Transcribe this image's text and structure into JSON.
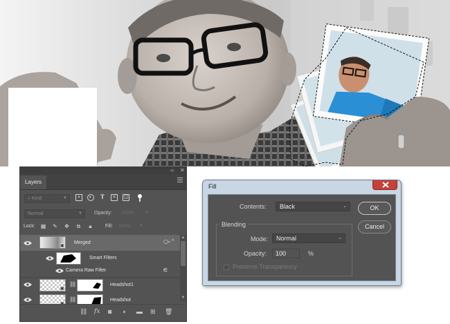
{
  "layers_panel": {
    "tab_label": "Layers",
    "filter_kind": "Kind",
    "blend_mode": "Normal",
    "opacity_label": "Opacity:",
    "opacity_value": "100%",
    "lock_label": "Lock:",
    "fill_label": "Fill:",
    "fill_value": "100%",
    "layers": [
      {
        "name": "Merged"
      },
      {
        "name": "Headshot1"
      },
      {
        "name": "Headshot"
      }
    ],
    "smart_filters_label": "Smart Filters",
    "camera_raw_label": "Camera Raw Filter",
    "fx_label": "fx"
  },
  "fill_dialog": {
    "title": "Fill",
    "contents_label": "Contents:",
    "contents_value": "Black",
    "ok_label": "OK",
    "cancel_label": "Cancel",
    "blending_label": "Blending",
    "mode_label": "Mode:",
    "mode_value": "Normal",
    "opacity_label": "Opacity:",
    "opacity_value": "100",
    "opacity_unit": "%",
    "preserve_label": "Preserve Transparency"
  },
  "colors": {
    "panel_bg": "#535353",
    "dialog_frame": "#c9d6e3",
    "close_red": "#c4423a",
    "shirt_blue": "#2a8fd4"
  }
}
